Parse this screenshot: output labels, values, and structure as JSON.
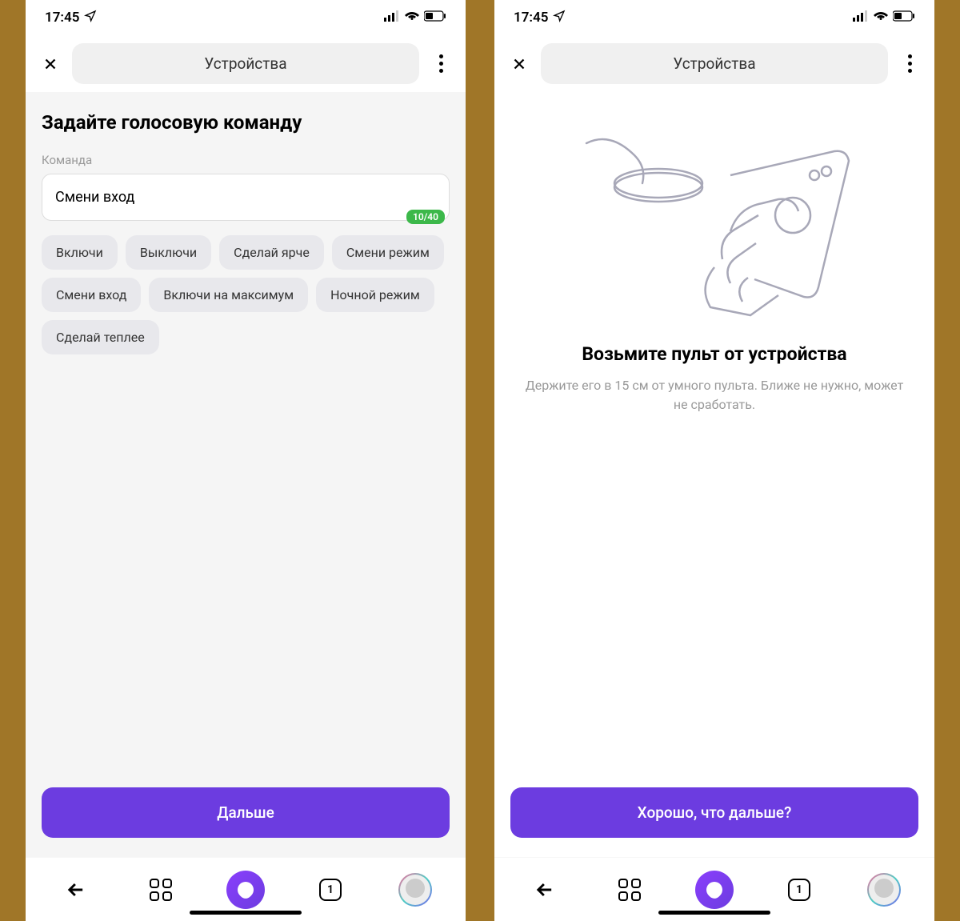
{
  "status": {
    "time": "17:45"
  },
  "header": {
    "title": "Устройства"
  },
  "left": {
    "heading": "Задайте голосовую команду",
    "field_label": "Команда",
    "input_value": "Смени вход",
    "char_count": "10/40",
    "chips": [
      "Включи",
      "Выключи",
      "Сделай ярче",
      "Смени режим",
      "Смени вход",
      "Включи на максимум",
      "Ночной режим",
      "Сделай теплее"
    ],
    "primary": "Дальше"
  },
  "right": {
    "heading": "Возьмите пульт от устройства",
    "sub": "Держите его в 15 см от умного пульта. Ближе не нужно, может не сработать.",
    "primary": "Хорошо, что дальше?"
  },
  "tabbar": {
    "tabs_count": "1"
  }
}
